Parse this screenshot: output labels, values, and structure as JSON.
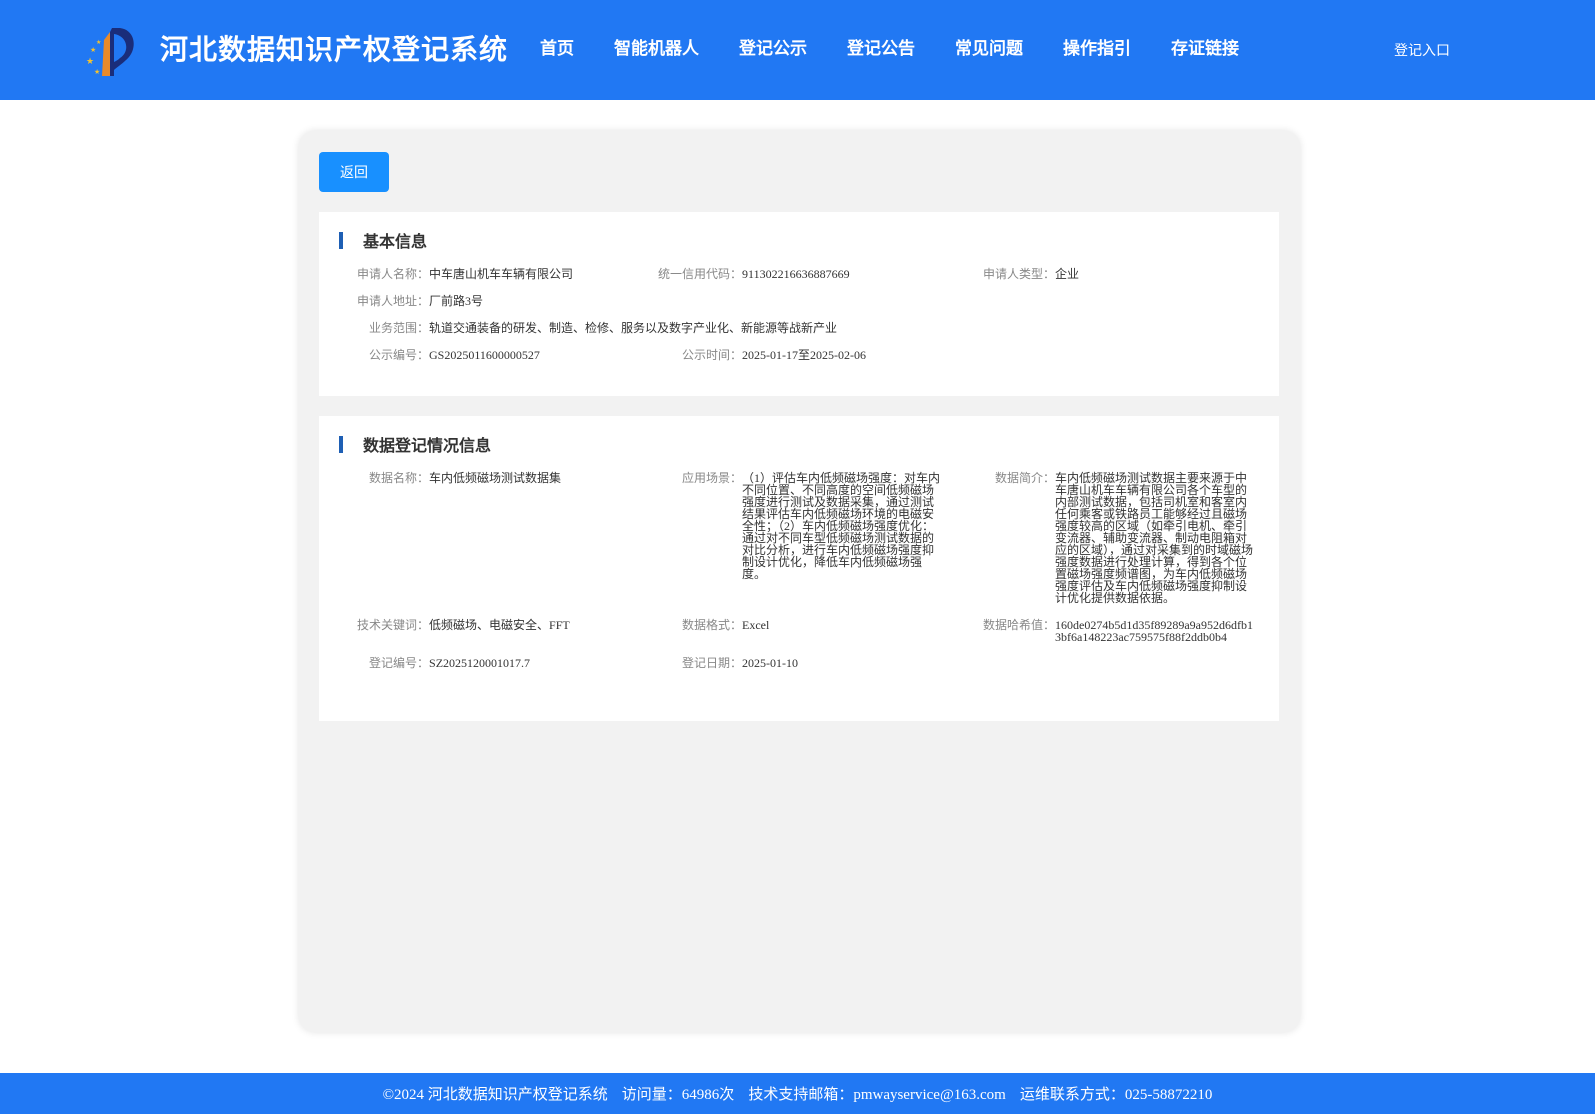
{
  "header": {
    "site_title": "河北数据知识产权登记系统",
    "nav": [
      "首页",
      "智能机器人",
      "登记公示",
      "登记公告",
      "常见问题",
      "操作指引",
      "存证链接"
    ],
    "login": "登记入口"
  },
  "back_label": "返回",
  "basic": {
    "title": "基本信息",
    "applicant_name_label": "申请人名称：",
    "applicant_name": "中车唐山机车车辆有限公司",
    "credit_code_label": "统一信用代码：",
    "credit_code": "911302216636887669",
    "applicant_type_label": "申请人类型：",
    "applicant_type": "企业",
    "address_label": "申请人地址：",
    "address": "厂前路3号",
    "scope_label": "业务范围：",
    "scope": "轨道交通装备的研发、制造、检修、服务以及数字产业化、新能源等战新产业",
    "notice_no_label": "公示编号：",
    "notice_no": "GS2025011600000527",
    "notice_time_label": "公示时间：",
    "notice_time": "2025-01-17至2025-02-06"
  },
  "data_reg": {
    "title": "数据登记情况信息",
    "name_label": "数据名称：",
    "name": "车内低频磁场测试数据集",
    "scenario_label": "应用场景：",
    "scenario": "（1）评估车内低频磁场强度：对车内不同位置、不同高度的空间低频磁场强度进行测试及数据采集，通过测试结果评估车内低频磁场环境的电磁安全性；（2）车内低频磁场强度优化：通过对不同车型低频磁场测试数据的对比分析，进行车内低频磁场强度抑制设计优化，降低车内低频磁场强度。",
    "intro_label": "数据简介：",
    "intro": "车内低频磁场测试数据主要来源于中车唐山机车车辆有限公司各个车型的内部测试数据，包括司机室和客室内任何乘客或铁路员工能够经过且磁场强度较高的区域（如牵引电机、牵引变流器、辅助变流器、制动电阻箱对应的区域），通过对采集到的时域磁场强度数据进行处理计算，得到各个位置磁场强度频谱图，为车内低频磁场强度评估及车内低频磁场强度抑制设计优化提供数据依据。",
    "keywords_label": "技术关键词：",
    "keywords": "低频磁场、电磁安全、FFT",
    "format_label": "数据格式：",
    "format": "Excel",
    "hash_label": "数据哈希值：",
    "hash": "160de0274b5d1d35f89289a9a952d6dfb13bf6a148223ac759575f88f2ddb0b4",
    "reg_no_label": "登记编号：",
    "reg_no": "SZ2025120001017.7",
    "reg_date_label": "登记日期：",
    "reg_date": "2025-01-10"
  },
  "footer": {
    "copyright": "©2024 河北数据知识产权登记系统",
    "visits": "访问量：64986次",
    "email": "技术支持邮箱：pmwayservice@163.com",
    "contact": "运维联系方式：025-58872210"
  },
  "colors": {
    "primary": "#2178f3",
    "button": "#1890ff",
    "section_bar": "#1e5fb4"
  }
}
